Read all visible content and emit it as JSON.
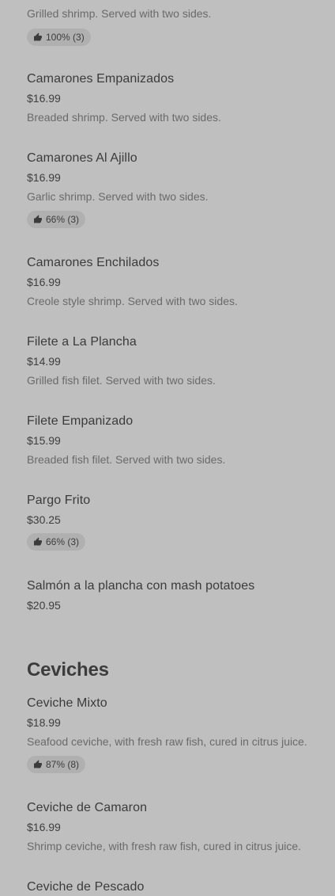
{
  "menu": {
    "partial_top": {
      "description": "Grilled shrimp. Served with two sides.",
      "rating": "100% (3)"
    },
    "items": [
      {
        "name": "Camarones Empanizados",
        "price": "$16.99",
        "description": "Breaded shrimp. Served with two sides."
      },
      {
        "name": "Camarones Al Ajillo",
        "price": "$16.99",
        "description": "Garlic shrimp. Served with two sides.",
        "rating": "66% (3)"
      },
      {
        "name": "Camarones Enchilados",
        "price": "$16.99",
        "description": "Creole style shrimp. Served with two sides."
      },
      {
        "name": "Filete a La Plancha",
        "price": "$14.99",
        "description": "Grilled fish filet. Served with two sides."
      },
      {
        "name": "Filete Empanizado",
        "price": "$15.99",
        "description": "Breaded fish filet. Served with two sides."
      },
      {
        "name": "Pargo Frito",
        "price": "$30.25",
        "rating": "66% (3)"
      },
      {
        "name": "Salmón a la plancha con mash potatoes",
        "price": "$20.95"
      }
    ],
    "ceviches": {
      "title": "Ceviches",
      "items": [
        {
          "name": "Ceviche Mixto",
          "price": "$18.99",
          "description": "Seafood ceviche, with fresh raw fish, cured in citrus juice.",
          "rating": "87% (8)"
        },
        {
          "name": "Ceviche de Camaron",
          "price": "$16.99",
          "description": "Shrimp ceviche, with fresh raw fish, cured in citrus juice."
        },
        {
          "name": "Ceviche de Pescado"
        }
      ]
    }
  },
  "icons": {
    "rating": "thumbs-up-icon"
  }
}
